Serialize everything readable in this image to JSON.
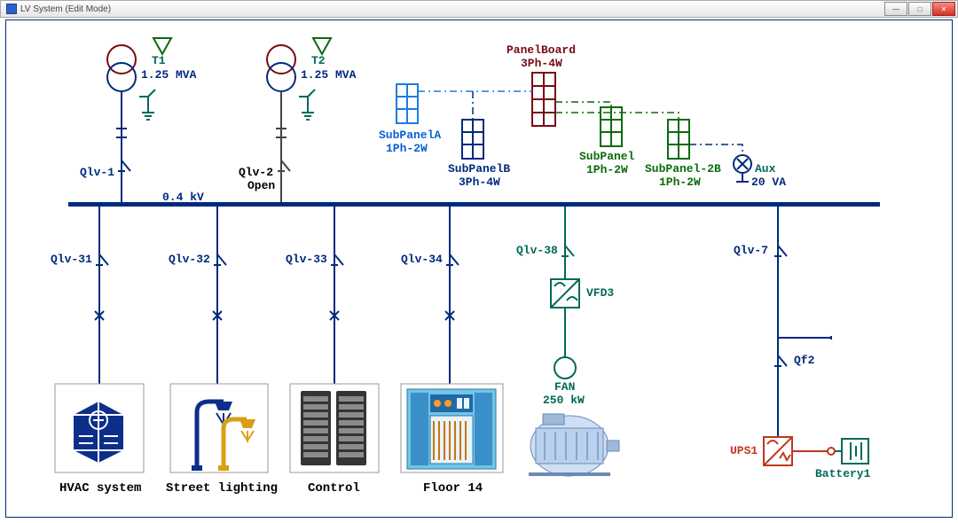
{
  "window": {
    "title": "LV System (Edit Mode)"
  },
  "transformers": {
    "t1": {
      "name": "T1",
      "rating": "1.25 MVA"
    },
    "t2": {
      "name": "T2",
      "rating": "1.25 MVA"
    }
  },
  "bus": {
    "voltage": "0.4 kV"
  },
  "incomers": {
    "q1": "Qlv-1",
    "q2": "Qlv-2",
    "q2_state": "Open"
  },
  "panels": {
    "main": {
      "name": "PanelBoard",
      "phases": "3Ph-4W"
    },
    "subA": {
      "name": "SubPanelA",
      "phases": "1Ph-2W"
    },
    "subB": {
      "name": "SubPanelB",
      "phases": "3Ph-4W"
    },
    "sub1": {
      "name": "SubPanel",
      "phases": "1Ph-2W"
    },
    "sub2B": {
      "name": "SubPanel-2B",
      "phases": "1Ph-2W"
    },
    "aux": {
      "name": "Aux",
      "rating": "20 VA"
    }
  },
  "feeders": {
    "f1": {
      "breaker": "Qlv-31",
      "caption": "HVAC system"
    },
    "f2": {
      "breaker": "Qlv-32",
      "caption": "Street lighting"
    },
    "f3": {
      "breaker": "Qlv-33",
      "caption": "Control"
    },
    "f4": {
      "breaker": "Qlv-34",
      "caption": "Floor 14"
    },
    "f5": {
      "breaker": "Qlv-38",
      "vfd": "VFD3",
      "load": "FAN",
      "rating": "250 kW"
    },
    "f6": {
      "breaker": "Qlv-7",
      "sub_breaker": "Qf2",
      "ups": "UPS1",
      "battery": "Battery1"
    }
  }
}
